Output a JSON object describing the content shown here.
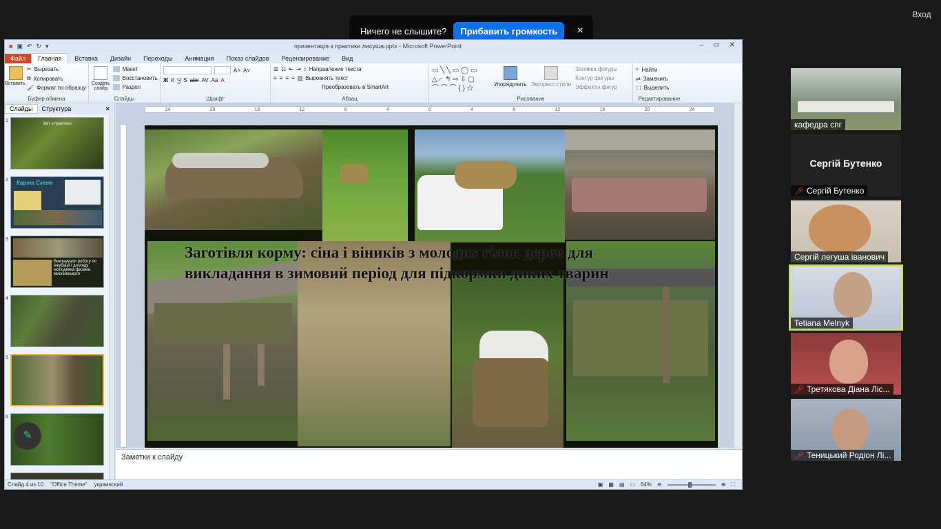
{
  "notification": {
    "text": "Ничего не слышите?",
    "button": "Прибавить громкость",
    "close": "×"
  },
  "login": "Вход",
  "ppt": {
    "window_title": "призентація з практики лисуша.pptx - Microsoft PowerPoint",
    "tabs": [
      "Файл",
      "Главная",
      "Вставка",
      "Дизайн",
      "Переходы",
      "Анимация",
      "Показ слайдов",
      "Рецензирование",
      "Вид"
    ],
    "active_tab": "Главная",
    "ribbon": {
      "clipboard": {
        "label": "Буфер обмена",
        "paste": "Вставить",
        "cut": "Вырезать",
        "copy": "Копировать",
        "format": "Формат по образцу"
      },
      "slides": {
        "label": "Слайды",
        "new": "Создать слайд",
        "layout": "Макет",
        "reset": "Восстановить",
        "section": "Раздел"
      },
      "font": {
        "label": "Шрифт"
      },
      "paragraph": {
        "label": "Абзац",
        "text_dir": "Направление текста",
        "align_text": "Выровнять текст",
        "smartart": "Преобразовать в SmartArt"
      },
      "drawing": {
        "label": "Рисование",
        "arrange": "Упорядочить",
        "quick_styles": "Экспресс-стили",
        "fill": "Заливка фигуры",
        "outline": "Контур фигуры",
        "effects": "Эффекты фигур"
      },
      "editing": {
        "label": "Редактирование",
        "find": "Найти",
        "replace": "Заменить",
        "select": "Выделить"
      }
    },
    "panel_tabs": [
      "Слайды",
      "Структура"
    ],
    "thumbs": [
      {
        "num": "1",
        "caption": "Звіт з практики"
      },
      {
        "num": "2",
        "caption": "Карта Схема"
      },
      {
        "num": "3",
        "caption": "Виконували роботу по інкубації і догляду молодняка фазана мисливського"
      },
      {
        "num": "4",
        "caption": ""
      },
      {
        "num": "5",
        "caption": ""
      },
      {
        "num": "6",
        "caption": ""
      }
    ],
    "ruler_marks": [
      "24",
      "22",
      "20",
      "18",
      "16",
      "14",
      "12",
      "10",
      "8",
      "6",
      "4",
      "2",
      "0",
      "2",
      "4",
      "6",
      "8",
      "10",
      "12",
      "14",
      "16",
      "18",
      "20",
      "22",
      "24"
    ],
    "slide_title": "Заготівля корму: сіна і віників з молодих гілок дерев для викладання в зимовий період для підкормки диких тварин",
    "notes": "Заметки к слайду",
    "status": {
      "slide": "Слайд 4 из 10",
      "theme": "\"Office Theme\"",
      "lang": "украинский",
      "zoom": "64%"
    }
  },
  "participants": [
    {
      "name": "кафедра спг",
      "muted": false,
      "type": "video"
    },
    {
      "name": "Сергій Бутенко",
      "big_name": "Сергій Бутенко",
      "muted": true,
      "type": "name"
    },
    {
      "name": "Сергій легуша іванович",
      "muted": false,
      "type": "video"
    },
    {
      "name": "Tetiana Melnyk",
      "muted": false,
      "type": "video",
      "active": true
    },
    {
      "name": "Третякова Діана  Ліс...",
      "muted": true,
      "type": "video"
    },
    {
      "name": "Теницький Родіон Лі...",
      "muted": true,
      "type": "video"
    }
  ],
  "colors": {
    "zoom_blue": "#0e71eb",
    "active_speaker": "#c8e06a",
    "file_tab": "#d24726",
    "mic_off": "#e23b3b"
  }
}
